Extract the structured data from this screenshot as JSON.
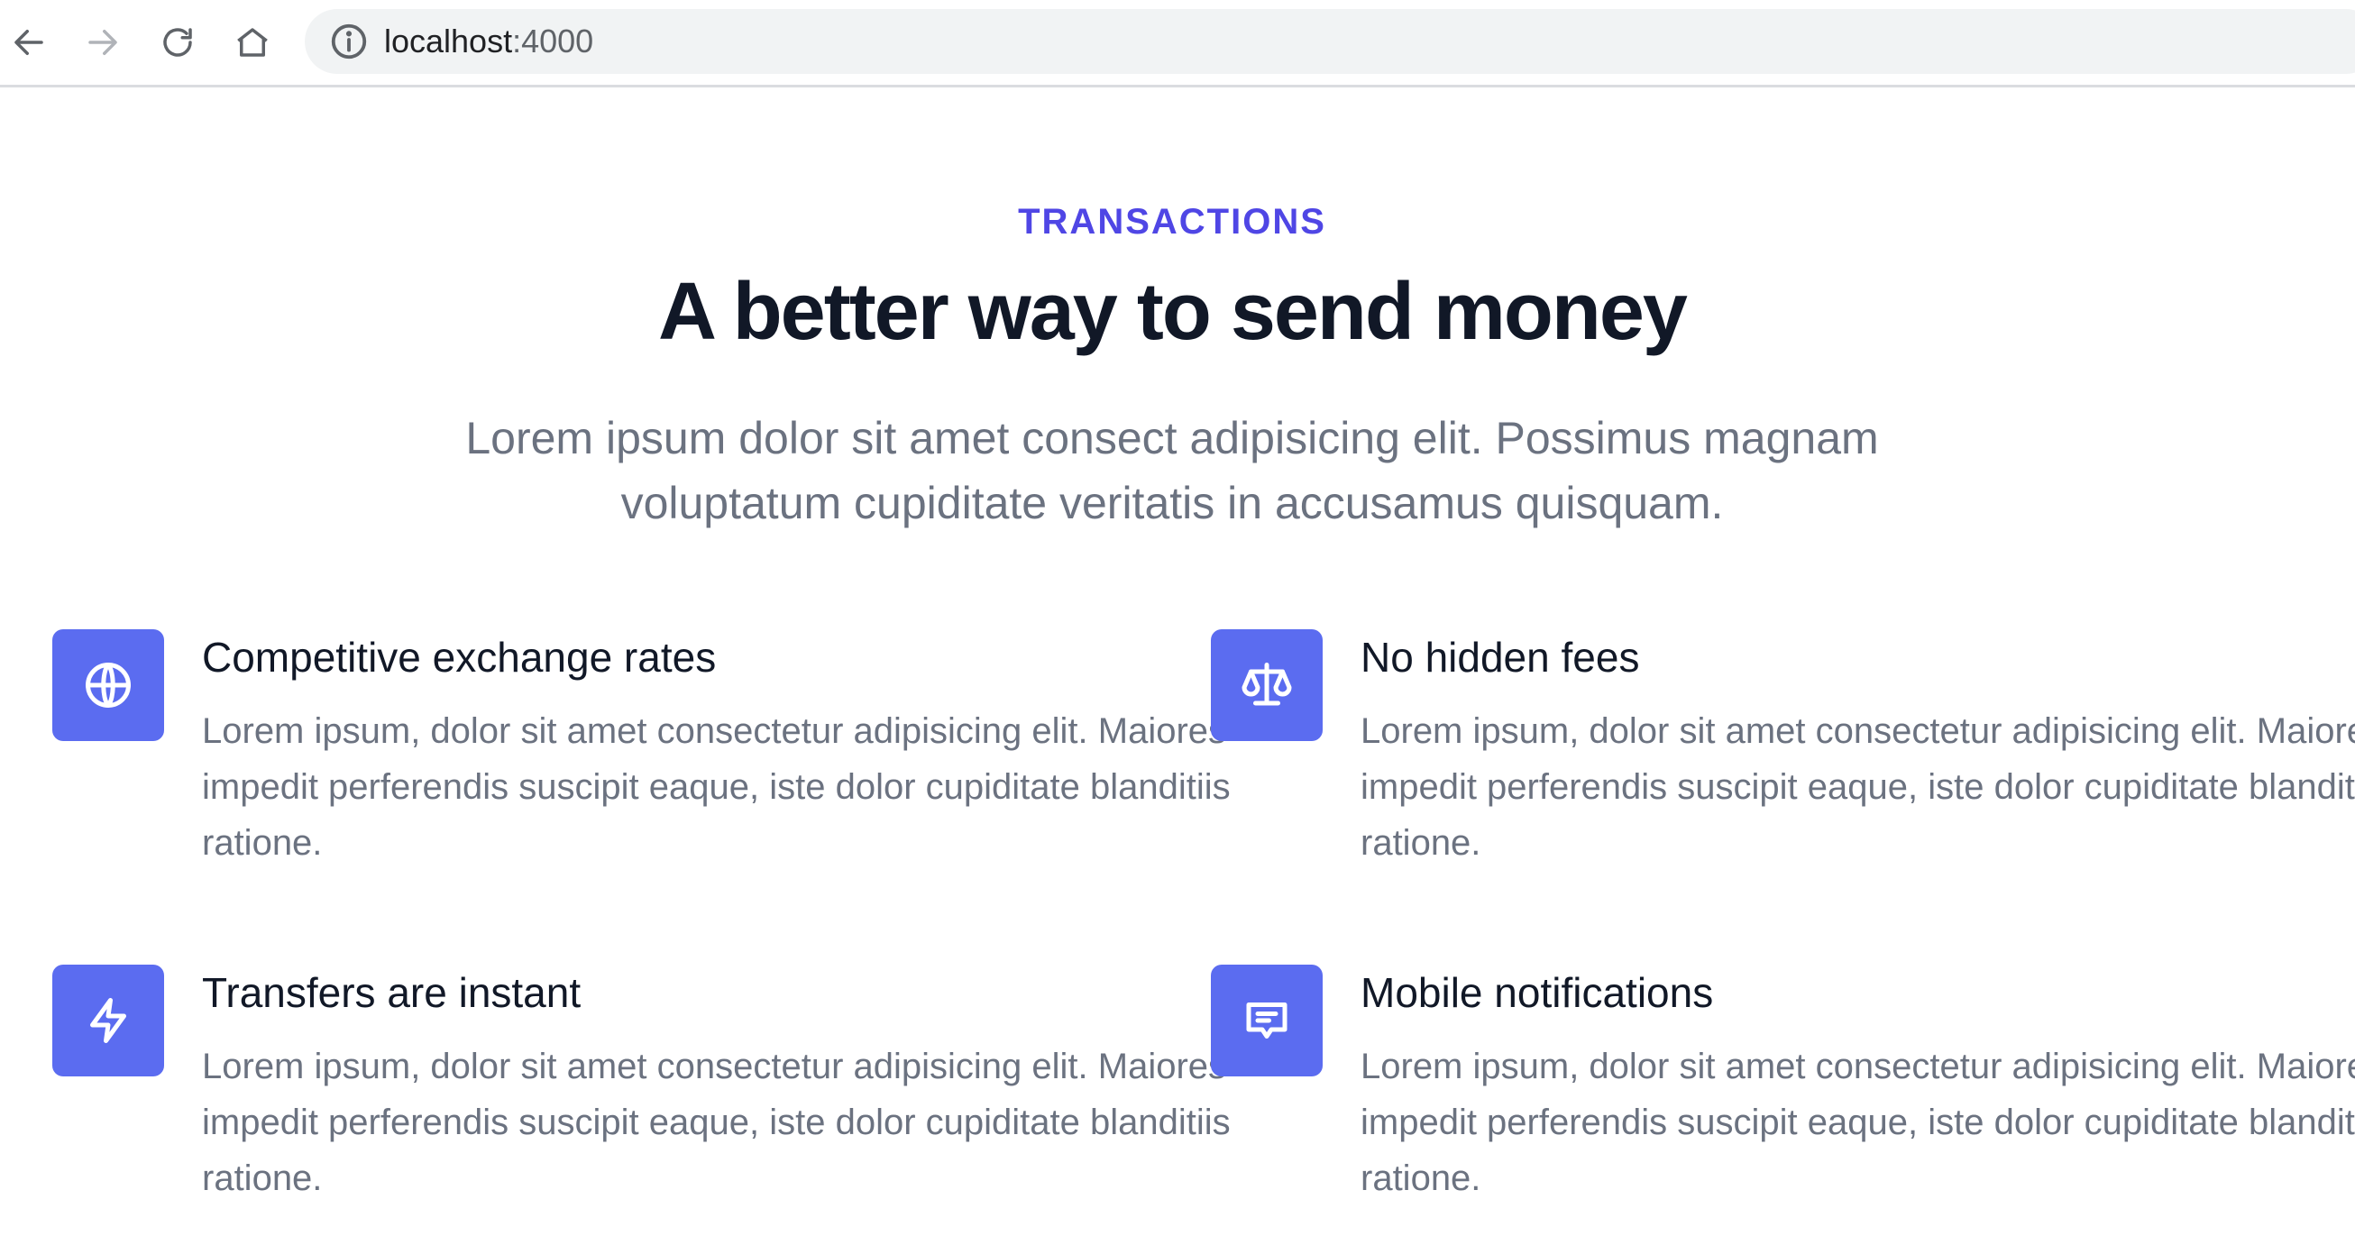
{
  "browser": {
    "url_host": "localhost",
    "url_port": ":4000",
    "icons": [
      "back-icon",
      "forward-icon",
      "reload-icon",
      "home-icon",
      "info-icon"
    ]
  },
  "hero": {
    "eyebrow": "TRANSACTIONS",
    "title": "A better way to send money",
    "subtitle": "Lorem ipsum dolor sit amet consect adipisicing elit. Possimus magnam voluptatum cupiditate veritatis in accusamus quisquam."
  },
  "features": [
    {
      "icon": "globe-icon",
      "title": "Competitive exchange rates",
      "description": "Lorem ipsum, dolor sit amet consectetur adipisicing elit. Maiores impedit perferendis suscipit eaque, iste dolor cupiditate blanditiis ratione."
    },
    {
      "icon": "scale-icon",
      "title": "No hidden fees",
      "description": "Lorem ipsum, dolor sit amet consectetur adipisicing elit. Maiores impedit perferendis suscipit eaque, iste dolor cupiditate blanditiis ratione."
    },
    {
      "icon": "lightning-bolt-icon",
      "title": "Transfers are instant",
      "description": "Lorem ipsum, dolor sit amet consectetur adipisicing elit. Maiores impedit perferendis suscipit eaque, iste dolor cupiditate blanditiis ratione."
    },
    {
      "icon": "chat-alt-icon",
      "title": "Mobile notifications",
      "description": "Lorem ipsum, dolor sit amet consectetur adipisicing elit. Maiores impedit perferendis suscipit eaque, iste dolor cupiditate blanditiis ratione."
    }
  ],
  "colors": {
    "accent": "#4f46e5",
    "icon_background": "#5b6cf0",
    "heading": "#111827",
    "body_text": "#6b7280"
  }
}
